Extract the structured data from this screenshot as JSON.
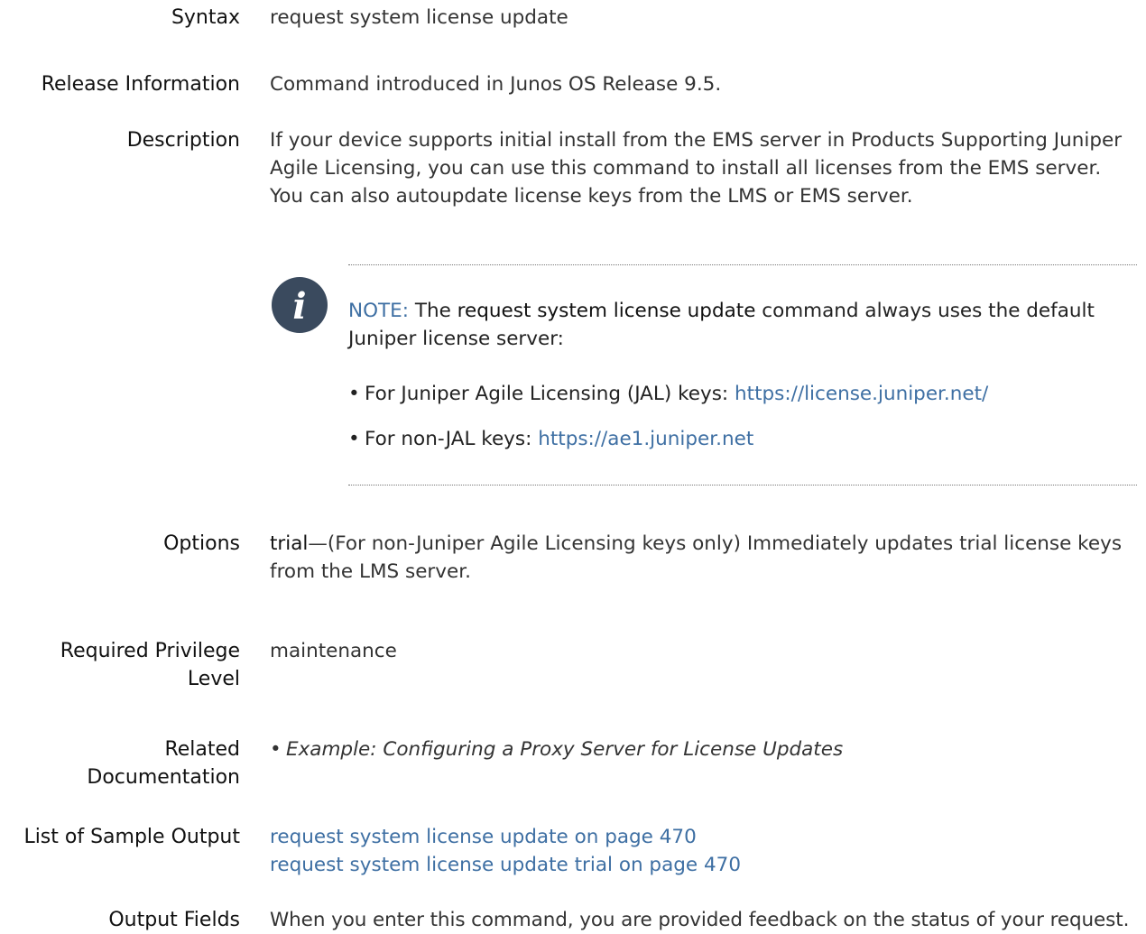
{
  "syntax": {
    "label": "Syntax",
    "text": "request system license update"
  },
  "release": {
    "label": "Release Information",
    "text": "Command introduced in Junos OS Release 9.5."
  },
  "description": {
    "label": "Description",
    "lines": [
      "If your device supports initial install from the EMS server in Products Supporting Juniper",
      "Agile Licensing, you can use this command to install all licenses from the EMS server.",
      "You can also autoupdate license keys from the LMS or EMS server."
    ]
  },
  "note": {
    "tag": "NOTE:",
    "pre": "The",
    "command": "request system license update",
    "post": "command always uses the default",
    "line2": "Juniper license server:",
    "bullets": [
      {
        "text": "For Juniper Agile Licensing (JAL) keys:",
        "link": "https://license.juniper.net/"
      },
      {
        "text": "For non-JAL keys:",
        "link": "https://ae1.juniper.net"
      }
    ]
  },
  "options": {
    "label": "Options",
    "term": "trial",
    "line1": "—(For non-Juniper Agile Licensing keys only) Immediately updates trial license keys",
    "line2": "from the LMS server."
  },
  "privilege": {
    "label_line1": "Required Privilege",
    "label_line2": "Level",
    "text": "maintenance"
  },
  "related": {
    "label_line1": "Related",
    "label_line2": "Documentation",
    "item": "Example: Configuring a Proxy Server for License Updates"
  },
  "sample_output": {
    "label": "List of Sample Output",
    "links": [
      "request system license update on page 470",
      "request system license update trial on page 470"
    ]
  },
  "output_fields": {
    "label": "Output Fields",
    "text": "When you enter this command, you are provided feedback on the status of your request."
  }
}
